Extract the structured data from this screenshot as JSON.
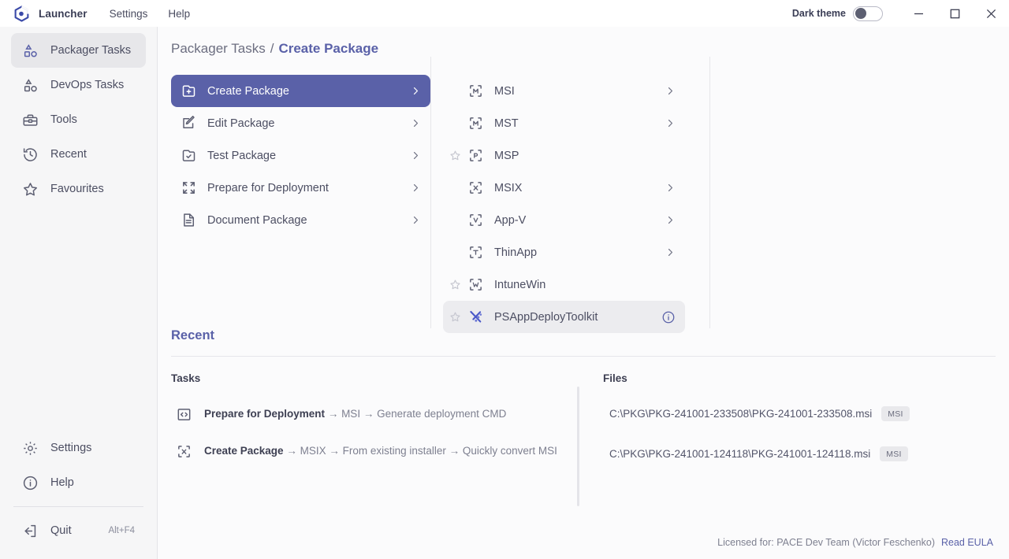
{
  "titlebar": {
    "logo_icon": "hexagon-logo-icon",
    "brand": "Launcher",
    "menu": [
      {
        "label": "Settings",
        "name": "menu-settings"
      },
      {
        "label": "Help",
        "name": "menu-help"
      }
    ],
    "dark_theme_label": "Dark theme",
    "dark_theme_on": false,
    "window_buttons": [
      {
        "name": "minimize-button",
        "icon": "minimize-icon"
      },
      {
        "name": "maximize-button",
        "icon": "maximize-icon"
      },
      {
        "name": "close-button",
        "icon": "close-icon"
      }
    ]
  },
  "sidebar": {
    "items": [
      {
        "label": "Packager Tasks",
        "icon": "shapes-icon",
        "active": true
      },
      {
        "label": "DevOps Tasks",
        "icon": "shapes-icon",
        "active": false
      },
      {
        "label": "Tools",
        "icon": "toolbox-icon",
        "active": false
      },
      {
        "label": "Recent",
        "icon": "clock-history-icon",
        "active": false
      },
      {
        "label": "Favourites",
        "icon": "star-icon",
        "active": false
      }
    ],
    "bottom_items": [
      {
        "label": "Settings",
        "icon": "gear-icon",
        "shortcut": ""
      },
      {
        "label": "Help",
        "icon": "info-circle-icon",
        "shortcut": ""
      }
    ],
    "quit": {
      "label": "Quit",
      "icon": "exit-icon",
      "shortcut": "Alt+F4"
    }
  },
  "breadcrumb": {
    "root": "Packager Tasks",
    "separator": "/",
    "current": "Create Package"
  },
  "tasks": [
    {
      "label": "Create Package",
      "icon": "folder-plus-icon",
      "selected": true,
      "chevron": true
    },
    {
      "label": "Edit Package",
      "icon": "edit-pencil-icon",
      "selected": false,
      "chevron": true
    },
    {
      "label": "Test Package",
      "icon": "folder-check-icon",
      "selected": false,
      "chevron": true
    },
    {
      "label": "Prepare for Deployment",
      "icon": "expand-arrows-icon",
      "selected": false,
      "chevron": true
    },
    {
      "label": "Document Package",
      "icon": "document-icon",
      "selected": false,
      "chevron": true
    }
  ],
  "formats": [
    {
      "label": "MSI",
      "icon": "bracket-m-icon",
      "favourite_star": false,
      "chevron": true,
      "info": false,
      "hovered": false
    },
    {
      "label": "MST",
      "icon": "bracket-m-icon",
      "favourite_star": false,
      "chevron": true,
      "info": false,
      "hovered": false
    },
    {
      "label": "MSP",
      "icon": "bracket-p-icon",
      "favourite_star": true,
      "chevron": false,
      "info": false,
      "hovered": false
    },
    {
      "label": "MSIX",
      "icon": "bracket-x-icon",
      "favourite_star": false,
      "chevron": true,
      "info": false,
      "hovered": false
    },
    {
      "label": "App-V",
      "icon": "bracket-v-icon",
      "favourite_star": false,
      "chevron": true,
      "info": false,
      "hovered": false
    },
    {
      "label": "ThinApp",
      "icon": "bracket-t-icon",
      "favourite_star": false,
      "chevron": true,
      "info": false,
      "hovered": false
    },
    {
      "label": "IntuneWin",
      "icon": "bracket-w-icon",
      "favourite_star": true,
      "chevron": false,
      "info": false,
      "hovered": false
    },
    {
      "label": "PSAppDeployToolkit",
      "icon": "psadt-icon",
      "favourite_star": true,
      "chevron": false,
      "info": true,
      "hovered": true
    }
  ],
  "recent": {
    "title": "Recent",
    "tasks_header": "Tasks",
    "files_header": "Files",
    "tasks": [
      {
        "name": "Prepare for Deployment",
        "path": "→ MSI → Generate deployment CMD",
        "icon": "code-brackets-icon"
      },
      {
        "name": "Create Package",
        "path": "→ MSIX → From existing installer → Quickly convert MSI",
        "icon": "bracket-x-icon"
      }
    ],
    "files": [
      {
        "path": "C:\\PKG\\PKG-241001-233508\\PKG-241001-233508.msi",
        "badge": "MSI"
      },
      {
        "path": "C:\\PKG\\PKG-241001-124118\\PKG-241001-124118.msi",
        "badge": "MSI"
      }
    ]
  },
  "footer": {
    "license": "Licensed for: PACE Dev Team (Victor Feschenko)",
    "eula_link": "Read EULA"
  },
  "colors": {
    "accent": "#5a61a8",
    "sidebar_bg": "#f6f6f7",
    "main_bg": "#fbfbfc",
    "text": "#3d3f52",
    "muted": "#7e8090"
  }
}
